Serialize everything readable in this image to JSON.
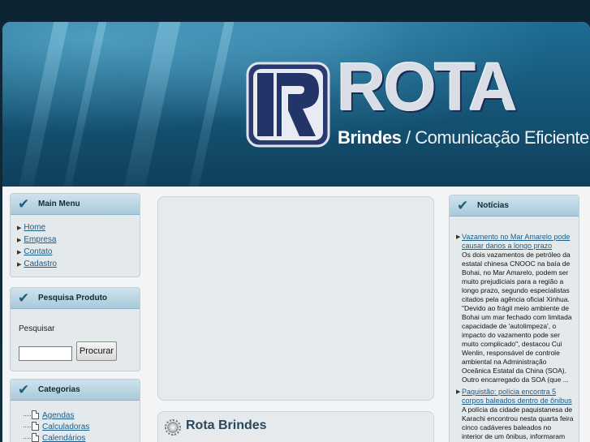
{
  "header": {
    "logo_word": "ROTA",
    "logo_sub_brand": "Brindes",
    "logo_sub_rest": "/ Comunicação Eficiente",
    "logo_mark_letter": "R"
  },
  "main_menu": {
    "title": "Main Menu",
    "items": [
      {
        "label": "Home"
      },
      {
        "label": "Empresa"
      },
      {
        "label": "Contato"
      },
      {
        "label": "Cadastro"
      }
    ]
  },
  "search": {
    "title": "Pesquisa Produto",
    "label": "Pesquisar",
    "value": "",
    "button_label": "Procurar"
  },
  "categories": {
    "title": "Categorias",
    "items": [
      {
        "label": "Agendas"
      },
      {
        "label": "Calculadoras"
      },
      {
        "label": "Calendários"
      }
    ]
  },
  "content": {
    "section_title": "Rota Brindes"
  },
  "news": {
    "title": "Notícias",
    "items": [
      {
        "headline": "Vazamento no Mar Amarelo pode causar danos a longo prazo",
        "summary": "Os dois vazamentos de petróleo da estatal chinesa CNOOC na baía de Bohai, no Mar Amarelo, podem ser muito prejudiciais para a região a longo prazo, segundo especialistas citados pela agência oficial Xinhua. \"Devido ao frágil meio ambiente de Bohai um mar fechado com limitada capacidade de 'autolimpeza', o impacto do vazamento pode ser muito complicado\", destacou Cui Wenlin, responsável de controle ambiental na Administração Oceânica Estatal da China (SOA). Outro encarregado da SOA (que ..."
      },
      {
        "headline": "Paquistão: polícia encontra 5 corpos baleados dentro de ônibus",
        "summary": "A polícia da cidade paquistanesa de Karachi encontrou nesta quarta feira cinco cadáveres baleados no interior de um ônibus, informaram fontes oficiais citadas"
      }
    ]
  },
  "colors": {
    "header_blue": "#175a7c",
    "link_blue": "#1a5c8a",
    "box_head": "#a9c9da"
  }
}
